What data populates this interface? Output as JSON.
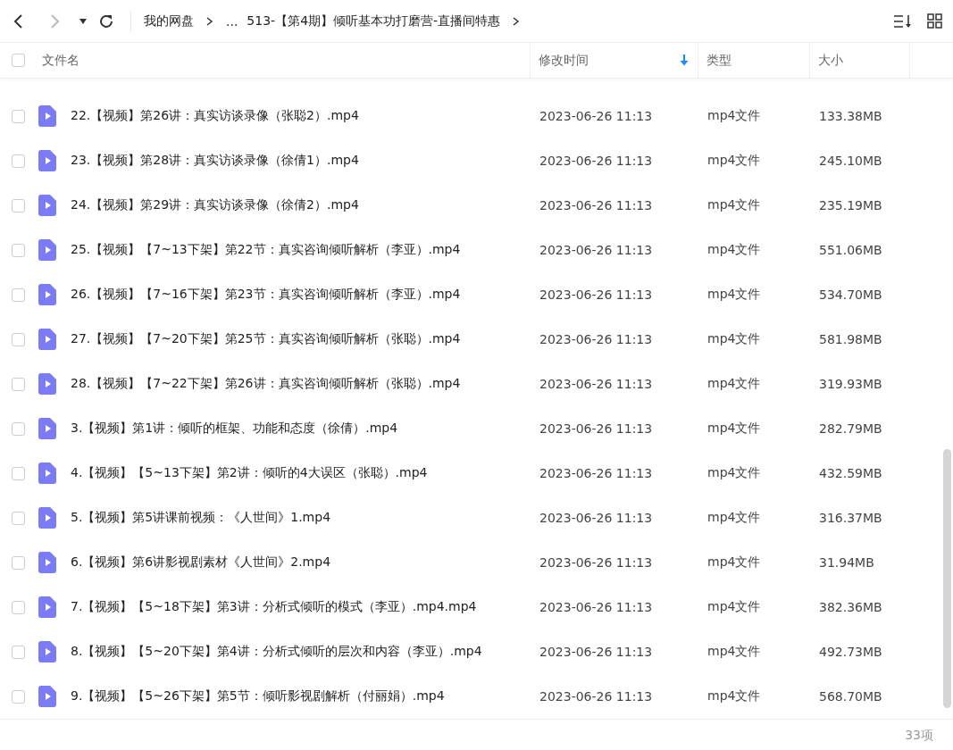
{
  "toolbar": {
    "breadcrumb": [
      {
        "label": "我的网盘",
        "chevron": true
      },
      {
        "label": "...",
        "chevron": false
      },
      {
        "label": "513-【第4期】倾听基本功打磨营-直播间特惠",
        "chevron": true
      }
    ],
    "back_disabled": false,
    "forward_disabled": true
  },
  "table": {
    "select_all": {
      "checked": false
    },
    "columns": [
      {
        "label": "文件名",
        "sorted": false
      },
      {
        "label": "修改时间",
        "sorted": true
      },
      {
        "label": "类型",
        "sorted": false
      },
      {
        "label": "大小",
        "sorted": false
      }
    ],
    "rows": [
      {
        "checked": false,
        "name": "22.【视频】第26讲：真实访谈录像（张聪2）.mp4",
        "modified": "2023-06-26 11:13",
        "type": "mp4文件",
        "size": "133.38MB"
      },
      {
        "checked": false,
        "name": "23.【视频】第28讲：真实访谈录像（徐倩1）.mp4",
        "modified": "2023-06-26 11:13",
        "type": "mp4文件",
        "size": "245.10MB"
      },
      {
        "checked": false,
        "name": "24.【视频】第29讲：真实访谈录像（徐倩2）.mp4",
        "modified": "2023-06-26 11:13",
        "type": "mp4文件",
        "size": "235.19MB"
      },
      {
        "checked": false,
        "name": "25.【视频】【7~13下架】第22节：真实咨询倾听解析（李亚）.mp4",
        "modified": "2023-06-26 11:13",
        "type": "mp4文件",
        "size": "551.06MB"
      },
      {
        "checked": false,
        "name": "26.【视频】【7~16下架】第23节：真实咨询倾听解析（李亚）.mp4",
        "modified": "2023-06-26 11:13",
        "type": "mp4文件",
        "size": "534.70MB"
      },
      {
        "checked": false,
        "name": "27.【视频】【7~20下架】第25节：真实咨询倾听解析（张聪）.mp4",
        "modified": "2023-06-26 11:13",
        "type": "mp4文件",
        "size": "581.98MB"
      },
      {
        "checked": false,
        "name": "28.【视频】【7~22下架】第26讲：真实咨询倾听解析（张聪）.mp4",
        "modified": "2023-06-26 11:13",
        "type": "mp4文件",
        "size": "319.93MB"
      },
      {
        "checked": false,
        "name": "3.【视频】第1讲：倾听的框架、功能和态度（徐倩）.mp4",
        "modified": "2023-06-26 11:13",
        "type": "mp4文件",
        "size": "282.79MB"
      },
      {
        "checked": false,
        "name": "4.【视频】【5~13下架】第2讲：倾听的4大误区（张聪）.mp4",
        "modified": "2023-06-26 11:13",
        "type": "mp4文件",
        "size": "432.59MB"
      },
      {
        "checked": false,
        "name": "5.【视频】第5讲课前视频：《人世间》1.mp4",
        "modified": "2023-06-26 11:13",
        "type": "mp4文件",
        "size": "316.37MB"
      },
      {
        "checked": false,
        "name": "6.【视频】第6讲影视剧素材《人世间》2.mp4",
        "modified": "2023-06-26 11:13",
        "type": "mp4文件",
        "size": "31.94MB"
      },
      {
        "checked": false,
        "name": "7.【视频】【5~18下架】第3讲：分析式倾听的模式（李亚）.mp4.mp4",
        "modified": "2023-06-26 11:13",
        "type": "mp4文件",
        "size": "382.36MB"
      },
      {
        "checked": false,
        "name": "8.【视频】【5~20下架】第4讲：分析式倾听的层次和内容（李亚）.mp4",
        "modified": "2023-06-26 11:13",
        "type": "mp4文件",
        "size": "492.73MB"
      },
      {
        "checked": false,
        "name": "9.【视频】【5~26下架】第5节：倾听影视剧解析（付丽娟）.mp4",
        "modified": "2023-06-26 11:13",
        "type": "mp4文件",
        "size": "568.70MB"
      }
    ]
  },
  "status_bar": {
    "count": "33项"
  }
}
